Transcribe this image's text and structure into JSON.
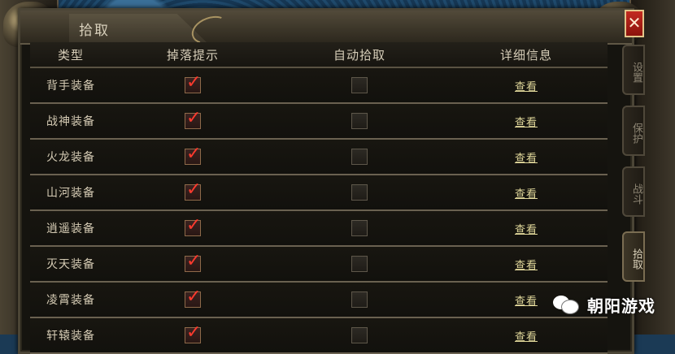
{
  "window": {
    "title": "拾取",
    "close_label": "✕"
  },
  "table": {
    "headers": [
      "类型",
      "掉落提示",
      "自动拾取",
      "详细信息"
    ],
    "rows": [
      {
        "name": "背手装备",
        "drop_alert": true,
        "auto_pickup": false,
        "detail": "查看"
      },
      {
        "name": "战神装备",
        "drop_alert": true,
        "auto_pickup": false,
        "detail": "查看"
      },
      {
        "name": "火龙装备",
        "drop_alert": true,
        "auto_pickup": false,
        "detail": "查看"
      },
      {
        "name": "山河装备",
        "drop_alert": true,
        "auto_pickup": false,
        "detail": "查看"
      },
      {
        "name": "逍遥装备",
        "drop_alert": true,
        "auto_pickup": false,
        "detail": "查看"
      },
      {
        "name": "灭天装备",
        "drop_alert": true,
        "auto_pickup": false,
        "detail": "查看"
      },
      {
        "name": "凌霄装备",
        "drop_alert": true,
        "auto_pickup": false,
        "detail": "查看"
      },
      {
        "name": "轩辕装备",
        "drop_alert": true,
        "auto_pickup": false,
        "detail": "查看"
      }
    ]
  },
  "side_tabs": [
    {
      "label": "设置",
      "active": false
    },
    {
      "label": "保护",
      "active": false
    },
    {
      "label": "战斗",
      "active": false
    },
    {
      "label": "拾取",
      "active": true
    }
  ],
  "watermark": {
    "text": "朝阳游戏"
  },
  "colors": {
    "check_mark": "#ff3a2e",
    "detail_link": "#e0d79a",
    "close_button": "#c32a20"
  }
}
